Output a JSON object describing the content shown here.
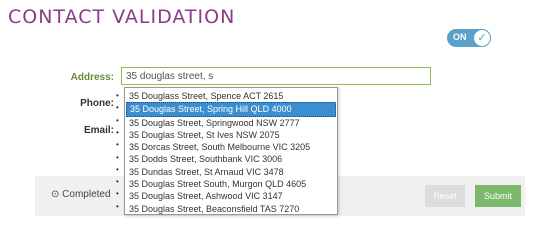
{
  "header": {
    "title": "CONTACT VALIDATION"
  },
  "toggle": {
    "label": "ON",
    "state": "on",
    "knob_icon": "check-icon"
  },
  "form": {
    "address_label": "Address:",
    "address_value": "35 douglas street, s",
    "phone_label": "Phone:",
    "email_label": "Email:"
  },
  "suggestions": {
    "selected_index": 1,
    "items": [
      "35 Douglass Street, Spence ACT 2615",
      "35 Douglas Street, Spring Hill QLD 4000",
      "35 Douglas Street, Springwood NSW 2777",
      "35 Douglas Street, St Ives NSW 2075",
      "35 Dorcas Street, South Melbourne VIC 3205",
      "35 Dodds Street, Southbank VIC 3006",
      "35 Dundas Street, St Arnaud VIC 3478",
      "35 Douglas Street South, Murgon QLD 4605",
      "35 Douglas Street, Ashwood VIC 3147",
      "35 Douglas Street, Beaconsfield TAS 7270"
    ]
  },
  "footer": {
    "completed_label": "Completed",
    "completed_icon": "clock-icon",
    "reset_label": "Reset",
    "submit_label": "Submit"
  },
  "colors": {
    "title": "#8e3a8a",
    "toggle": "#5ba0c8",
    "input_border": "#8cc152",
    "selected_item": "#3b8fd1",
    "submit": "#7cb86b"
  }
}
